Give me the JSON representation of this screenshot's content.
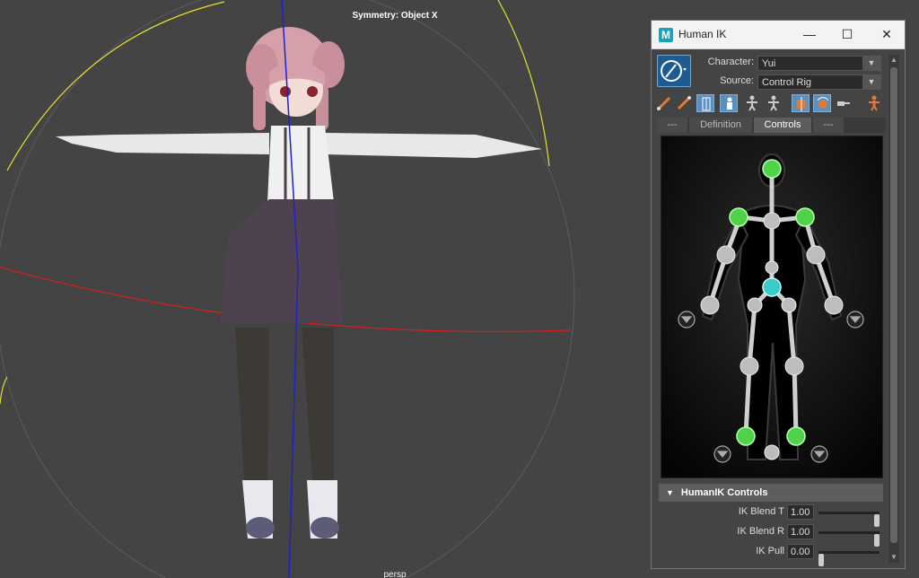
{
  "viewport": {
    "symmetry_label": "Symmetry: Object X",
    "camera_label": "persp"
  },
  "window": {
    "title": "Human IK",
    "app_icon": "M",
    "minimize_glyph": "—",
    "maximize_glyph": "☐",
    "close_glyph": "✕"
  },
  "character": {
    "label": "Character:",
    "value": "Yui"
  },
  "source": {
    "label": "Source:",
    "value": "Control Rig"
  },
  "toolbar": {
    "icons": [
      "pencil-icon",
      "pencil-icon",
      "skeleton-select-icon",
      "body-part-icon",
      "full-body-icon",
      "selection-icon",
      "pin-translation-icon",
      "pin-rotation-icon",
      "key-icon",
      "figure-orange-icon"
    ]
  },
  "tabs": [
    {
      "label": "---"
    },
    {
      "label": "Definition"
    },
    {
      "label": "Controls"
    },
    {
      "label": "---"
    }
  ],
  "controls": {
    "header": "HumanIK Controls",
    "ik_blend_t": {
      "label": "IK Blend T",
      "value": "1.00",
      "level": 1.0
    },
    "ik_blend_r": {
      "label": "IK Blend R",
      "value": "1.00",
      "level": 1.0
    },
    "ik_pull": {
      "label": "IK Pull",
      "value": "0.00",
      "level": 0.0
    }
  },
  "colors": {
    "effector_green": "#4fd24a",
    "effector_cyan": "#3ccbc7",
    "bone_grey": "#cfcfcf",
    "selected_tool": "#5a8fbf"
  }
}
